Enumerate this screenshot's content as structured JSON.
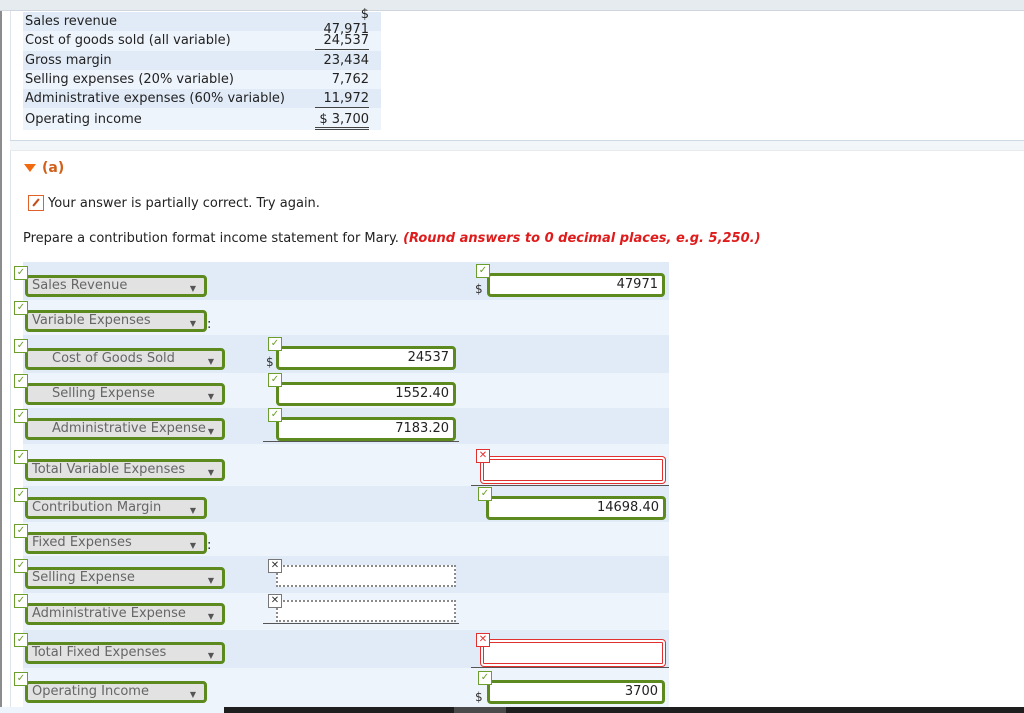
{
  "given_statement": {
    "rows": [
      {
        "label": "Sales revenue",
        "value": "$ 47,971"
      },
      {
        "label": "Cost of goods sold (all variable)",
        "value": "24,537"
      },
      {
        "label": "Gross margin",
        "value": "23,434"
      },
      {
        "label": "Selling expenses (20% variable)",
        "value": "7,762"
      },
      {
        "label": "Administrative expenses (60% variable)",
        "value": "11,972"
      },
      {
        "label": "Operating income",
        "value": "$  3,700"
      }
    ]
  },
  "part": {
    "label": "(a)",
    "feedback": "Your answer is partially correct.  Try again.",
    "instruction": "Prepare a contribution format income statement for Mary.",
    "instruction_note": "(Round answers to 0 decimal places, e.g. 5,250.)"
  },
  "answer_rows": [
    {
      "select": "Sales Revenue",
      "select_status": "correct",
      "col2_value": "47971",
      "col2_status": "correct",
      "col2_dollar": "$"
    },
    {
      "select": "Variable Expenses",
      "select_status": "correct",
      "colon": ":"
    },
    {
      "select": "Cost of Goods Sold",
      "select_status": "correct",
      "col1_value": "24537",
      "col1_status": "correct",
      "col1_dollar": "$"
    },
    {
      "select": "Selling Expense",
      "select_status": "correct",
      "col1_value": "1552.40",
      "col1_status": "correct"
    },
    {
      "select": "Administrative Expense",
      "select_status": "correct",
      "col1_value": "7183.20",
      "col1_status": "correct"
    },
    {
      "select": "Total Variable Expenses",
      "select_status": "correct",
      "col2_value": "",
      "col2_status": "incorrect"
    },
    {
      "select": "Contribution Margin",
      "select_status": "correct",
      "col2_value": "14698.40",
      "col2_status": "correct"
    },
    {
      "select": "Fixed Expenses",
      "select_status": "correct",
      "colon": ":"
    },
    {
      "select": "Selling Expense",
      "select_status": "correct",
      "col1_value": "",
      "col1_status": "unanswered"
    },
    {
      "select": "Administrative Expense",
      "select_status": "correct",
      "col1_value": "",
      "col1_status": "unanswered"
    },
    {
      "select": "Total Fixed Expenses",
      "select_status": "correct",
      "col2_value": "",
      "col2_status": "incorrect"
    },
    {
      "select": "Operating Income",
      "select_status": "correct",
      "col2_value": "3700",
      "col2_status": "correct",
      "col2_dollar": "$"
    }
  ],
  "icons": {
    "correct": "✓",
    "incorrect": "✕",
    "unanswered": "✕",
    "dropdown": "▼"
  },
  "colors": {
    "correct": "#5d8a1e",
    "incorrect": "#e0302f",
    "heading": "#d0601a",
    "note": "#e01b1b"
  }
}
